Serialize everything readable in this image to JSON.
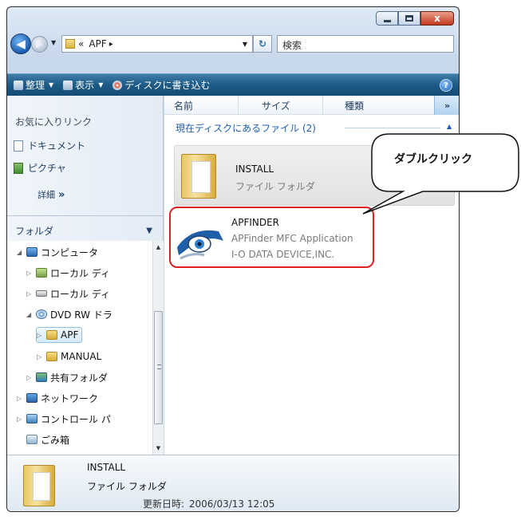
{
  "window": {
    "close_glyph": "x"
  },
  "address": {
    "prefix": "«",
    "path": "APF",
    "separator": "▸",
    "back_glyph": "◀",
    "forward_glyph": "▶"
  },
  "search": {
    "placeholder": "検索"
  },
  "commandbar": {
    "organize": "整理",
    "views": "表示",
    "burn": "ディスクに書き込む",
    "help": "?"
  },
  "favorites": {
    "title": "お気に入りリンク",
    "items": [
      {
        "label": "ドキュメント",
        "icon": "document-icon"
      },
      {
        "label": "ピクチャ",
        "icon": "picture-icon"
      }
    ],
    "more_label": "詳細",
    "more_glyph": "»"
  },
  "folders": {
    "title": "フォルダ",
    "tree": [
      {
        "label": "コンピュータ",
        "icon": "computer-icon"
      },
      {
        "label": "ローカル ディ",
        "icon": "local-disk-icon"
      },
      {
        "label": "ローカル ディ",
        "icon": "local-disk-icon"
      },
      {
        "label": "DVD RW ドラ",
        "icon": "dvd-drive-icon"
      },
      {
        "label": "APF",
        "icon": "folder-icon"
      },
      {
        "label": "MANUAL",
        "icon": "folder-icon"
      },
      {
        "label": "共有フォルダ",
        "icon": "shared-folder-icon"
      },
      {
        "label": "ネットワーク",
        "icon": "network-icon"
      },
      {
        "label": "コントロール パ",
        "icon": "control-panel-icon"
      },
      {
        "label": "ごみ箱",
        "icon": "recycle-bin-icon"
      }
    ]
  },
  "columns": {
    "name": "名前",
    "size": "サイズ",
    "type": "種類",
    "more": "»"
  },
  "group": {
    "title": "現在ディスクにあるファイル (2)"
  },
  "files": [
    {
      "name": "INSTALL",
      "type": "ファイル フォルダ"
    },
    {
      "name": "APFINDER",
      "description": "APFinder MFC Application",
      "company": "I-O DATA DEVICE,INC."
    }
  ],
  "details": {
    "name": "INSTALL",
    "type": "ファイル フォルダ",
    "modified_label": "更新日時:",
    "modified_value": "2006/03/13 12:05"
  },
  "annotation": {
    "callout": "ダブルクリック",
    "highlight_color": "#e02020"
  }
}
